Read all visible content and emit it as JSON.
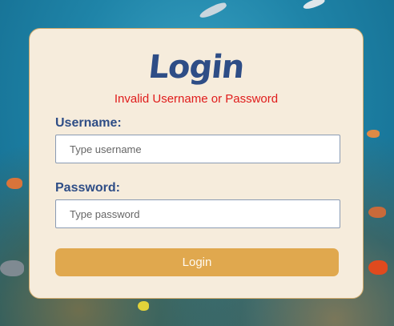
{
  "form": {
    "title": "Login",
    "error_message": "Invalid Username or Password",
    "username_label": "Username:",
    "username_placeholder": "Type username",
    "password_label": "Password:",
    "password_placeholder": "Type password",
    "submit_label": "Login"
  },
  "colors": {
    "card_background": "#f6ecdc",
    "title": "#2e4d86",
    "error": "#e01b1b",
    "button": "#e0a84e"
  }
}
